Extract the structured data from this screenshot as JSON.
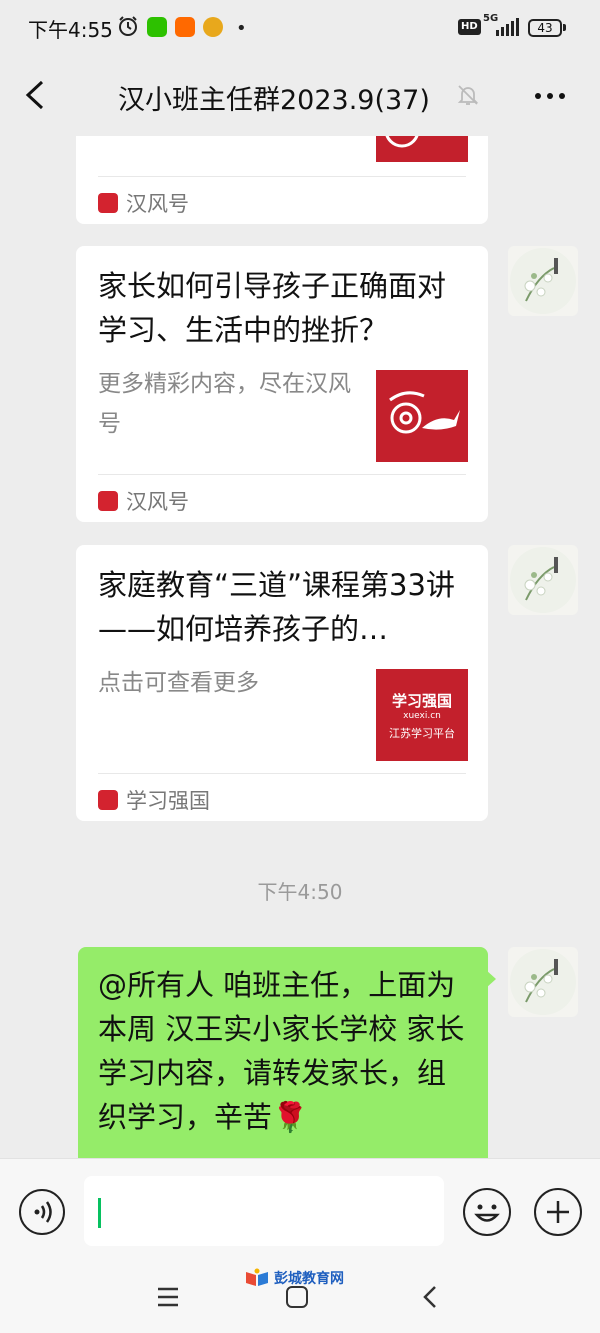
{
  "status_bar": {
    "time": "下午4:55",
    "network_hd": "HD",
    "network_5g": "5G",
    "battery": "43"
  },
  "header": {
    "title": "汉小班主任群2023.9(37)"
  },
  "messages": {
    "card_top": {
      "source": "汉风号"
    },
    "card_1": {
      "title": "家长如何引导孩子正确面对学习、生活中的挫折？",
      "desc": "更多精彩内容，尽在汉风号",
      "source": "汉风号"
    },
    "card_2": {
      "title": "家庭教育“三道”课程第33讲——如何培养孩子的…",
      "desc": "点击可查看更多",
      "thumb_brand": "学习强国",
      "thumb_url": "xuexi.cn",
      "thumb_sub": "江苏学习平台",
      "source": "学习强国"
    },
    "timestamp": "下午4:50",
    "text_message": "@所有人  咱班主任，上面为本周 汉王实小家长学校 家长学习内容，请转发家长，组织学习，辛苦🌹"
  },
  "watermark": "彭城教育网",
  "colors": {
    "bubble_green": "#95ec69",
    "accent_green": "#07c160",
    "thumb_red": "#c3202c",
    "background": "#ededed"
  }
}
